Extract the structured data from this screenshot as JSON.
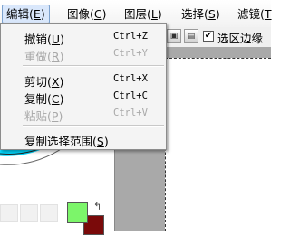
{
  "menubar": {
    "items": [
      {
        "label": "编辑",
        "key": "E",
        "close": ")"
      },
      {
        "label": "图像",
        "key": "C",
        "close": ")"
      },
      {
        "label": "图层",
        "key": "L",
        "close": ")"
      },
      {
        "label": "选择",
        "key": "S",
        "close": ")"
      },
      {
        "label": "滤镜",
        "key": "T",
        "close": ""
      }
    ]
  },
  "edit_menu": {
    "items": [
      {
        "label": "撤销",
        "key": "U",
        "shortcut": "Ctrl+Z",
        "enabled": true
      },
      {
        "label": "重做",
        "key": "R",
        "shortcut": "Ctrl+Y",
        "enabled": false
      },
      {
        "label": "剪切",
        "key": "X",
        "shortcut": "Ctrl+X",
        "enabled": true
      },
      {
        "label": "复制",
        "key": "C",
        "shortcut": "Ctrl+C",
        "enabled": true
      },
      {
        "label": "粘贴",
        "key": "P",
        "shortcut": "Ctrl+V",
        "enabled": false
      },
      {
        "label": "复制选择范围",
        "key": "S",
        "shortcut": "",
        "enabled": true
      }
    ]
  },
  "toolbar": {
    "checkbox_label": "选区边缘",
    "checkbox_checked": "✔"
  },
  "colors": {
    "foreground": "#7cf56a",
    "background": "#7a0a0a",
    "swap_icon": "↰"
  }
}
